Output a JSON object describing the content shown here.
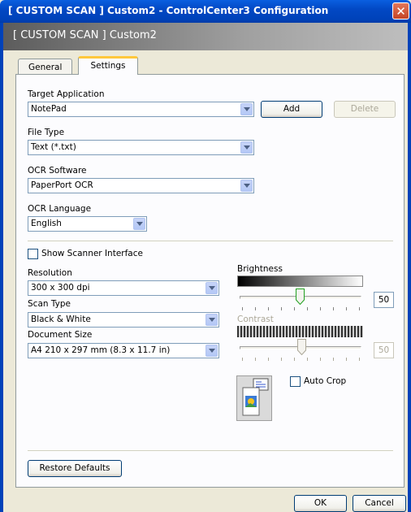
{
  "window": {
    "title": "[ CUSTOM SCAN ]  Custom2 - ControlCenter3 Configuration",
    "close_glyph": "✕"
  },
  "header": {
    "text": "[ CUSTOM SCAN ]  Custom2"
  },
  "tabs": [
    {
      "label": "General"
    },
    {
      "label": "Settings",
      "active": true
    }
  ],
  "target_app": {
    "label": "Target Application",
    "value": "NotePad",
    "add_label": "Add",
    "delete_label": "Delete"
  },
  "file_type": {
    "label": "File Type",
    "value": "Text (*.txt)"
  },
  "ocr_software": {
    "label": "OCR Software",
    "value": "PaperPort OCR"
  },
  "ocr_language": {
    "label": "OCR Language",
    "value": "English"
  },
  "show_scanner": {
    "label": "Show Scanner Interface",
    "checked": false
  },
  "resolution": {
    "label": "Resolution",
    "value": "300 x 300 dpi"
  },
  "scan_type": {
    "label": "Scan Type",
    "value": "Black & White"
  },
  "document_size": {
    "label": "Document Size",
    "value": "A4 210 x 297 mm (8.3 x 11.7 in)"
  },
  "brightness": {
    "label": "Brightness",
    "value": "50"
  },
  "contrast": {
    "label": "Contrast",
    "value": "50",
    "enabled": false
  },
  "auto_crop": {
    "label": "Auto Crop",
    "checked": false
  },
  "restore_label": "Restore Defaults",
  "ok_label": "OK",
  "cancel_label": "Cancel",
  "colors": {
    "title_blue": "#0042B9",
    "tab_highlight": "#FFC83C",
    "dialog_bg": "#ECE9D8"
  }
}
